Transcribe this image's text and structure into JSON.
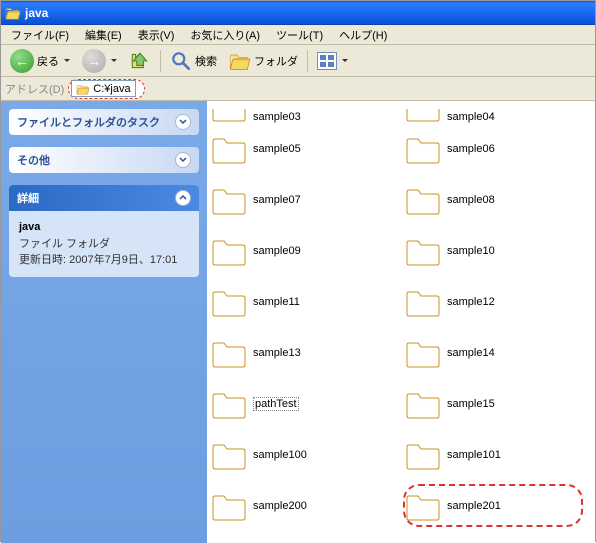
{
  "title": "java",
  "menu": {
    "file": "ファイル(F)",
    "edit": "編集(E)",
    "view": "表示(V)",
    "favorites": "お気に入り(A)",
    "tools": "ツール(T)",
    "help": "ヘルプ(H)"
  },
  "toolbar": {
    "back": "戻る",
    "search": "検索",
    "folders": "フォルダ"
  },
  "address": {
    "label": "アドレス(D)",
    "path": "C:¥java"
  },
  "sidebar": {
    "tasks_title": "ファイルとフォルダのタスク",
    "other_title": "その他",
    "details_title": "詳細",
    "details": {
      "name": "java",
      "type": "ファイル フォルダ",
      "modified_label": "更新日時:",
      "modified_value": "2007年7月9日、17:01"
    }
  },
  "folders": [
    {
      "name": "sample03",
      "partial": true
    },
    {
      "name": "sample04",
      "partial": true
    },
    {
      "name": "sample05"
    },
    {
      "name": "sample06"
    },
    {
      "name": "sample07"
    },
    {
      "name": "sample08"
    },
    {
      "name": "sample09"
    },
    {
      "name": "sample10"
    },
    {
      "name": "sample11"
    },
    {
      "name": "sample12"
    },
    {
      "name": "sample13"
    },
    {
      "name": "sample14"
    },
    {
      "name": "pathTest",
      "selected": true
    },
    {
      "name": "sample15"
    },
    {
      "name": "sample100"
    },
    {
      "name": "sample101"
    },
    {
      "name": "sample200"
    },
    {
      "name": "sample201",
      "highlighted": true
    }
  ]
}
